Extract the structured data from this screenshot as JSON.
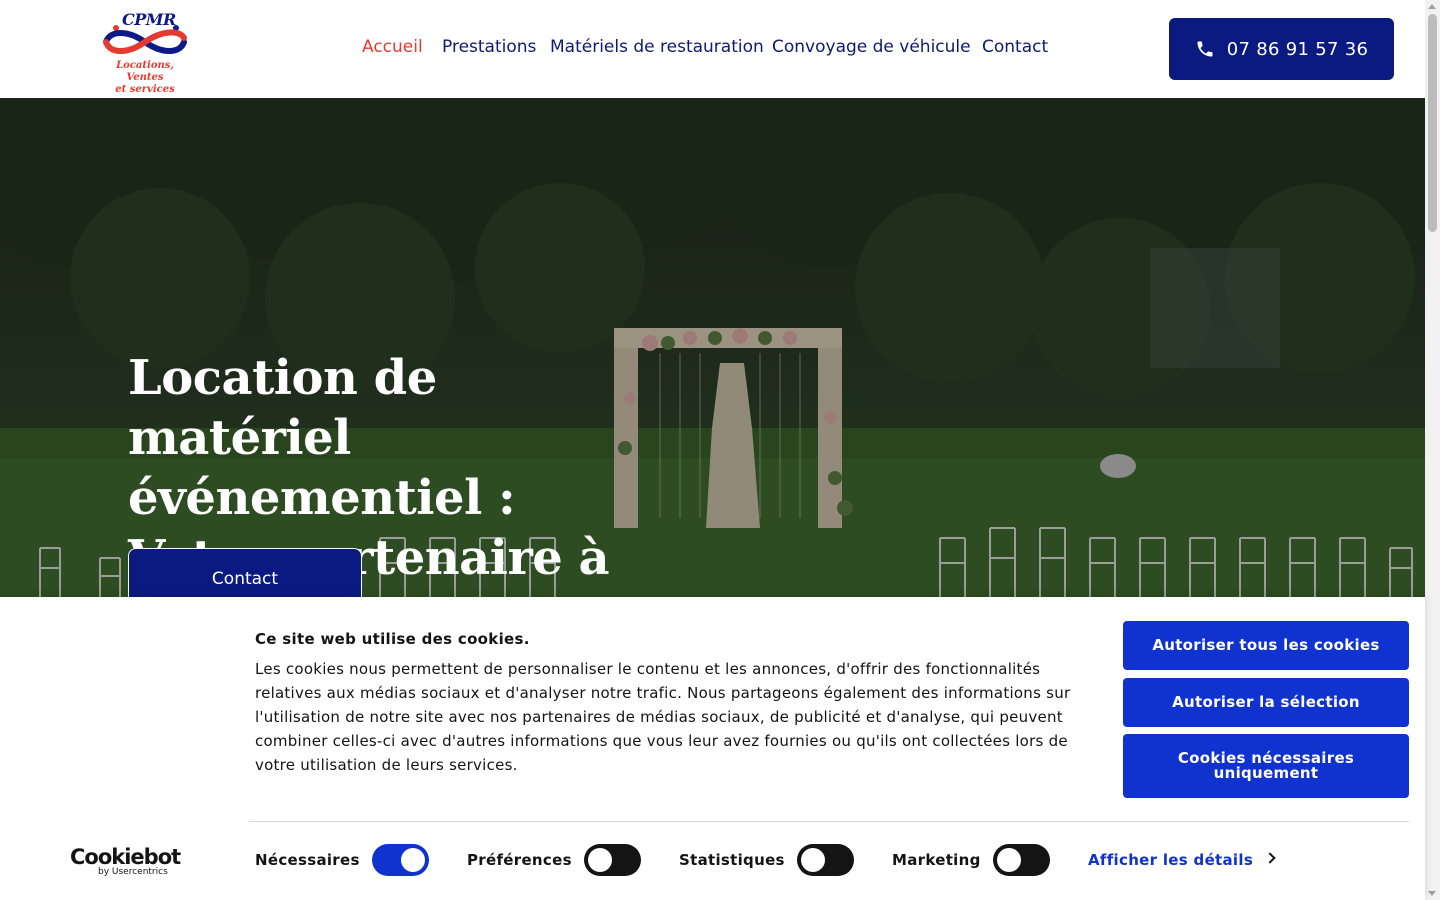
{
  "brand": {
    "name": "CPMR",
    "tagline_line1": "Locations, Ventes",
    "tagline_line2": "et services",
    "colors": {
      "navy": "#0a1a80",
      "red": "#e53a2f"
    }
  },
  "nav": {
    "items": [
      {
        "label": "Accueil",
        "active": true
      },
      {
        "label": "Prestations",
        "active": false
      },
      {
        "label": "Matériels de restauration",
        "active": false
      },
      {
        "label": "Convoyage de véhicule",
        "active": false
      },
      {
        "label": "Contact",
        "active": false
      }
    ]
  },
  "header": {
    "phone": "07 86 91 57 36",
    "phone_icon": "phone-icon"
  },
  "hero": {
    "title": "Location de matériel événementiel : Votre partenaire à Eppes",
    "cta_label": "Contact"
  },
  "cookie_banner": {
    "title": "Ce site web utilise des cookies.",
    "body": "Les cookies nous permettent de personnaliser le contenu et les annonces, d'offrir des fonctionnalités relatives aux médias sociaux et d'analyser notre trafic. Nous partageons également des informations sur l'utilisation de notre site avec nos partenaires de médias sociaux, de publicité et d'analyse, qui peuvent combiner celles-ci avec d'autres informations que vous leur avez fournies ou qu'ils ont collectées lors de votre utilisation de leurs services.",
    "buttons": {
      "allow_all": "Autoriser tous les cookies",
      "allow_selection": "Autoriser la sélection",
      "necessary_only": "Cookies nécessaires uniquement"
    },
    "toggles": [
      {
        "label": "Nécessaires",
        "on": true
      },
      {
        "label": "Préférences",
        "on": false
      },
      {
        "label": "Statistiques",
        "on": false
      },
      {
        "label": "Marketing",
        "on": false
      }
    ],
    "details_link": "Afficher les détails",
    "provider_logo": "Cookiebot",
    "provider_sub": "by Usercentrics",
    "accent_color": "#1032cf"
  }
}
